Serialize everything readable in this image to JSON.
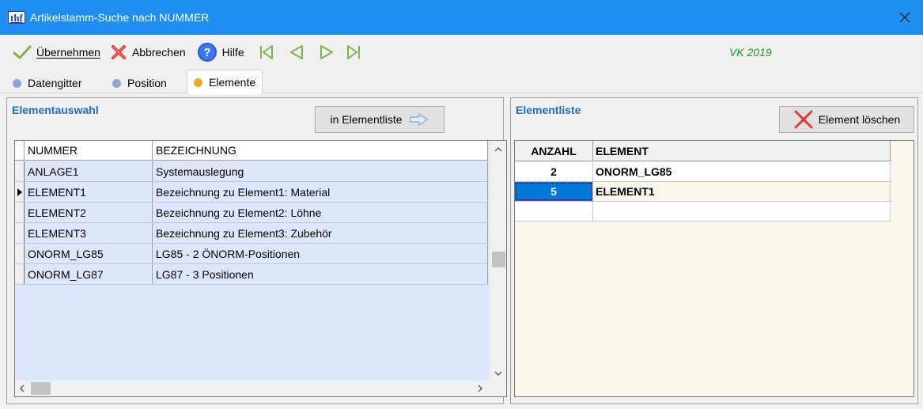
{
  "window": {
    "logo": "thf",
    "title": "Artikelstamm-Suche nach NUMMER",
    "close": "✕"
  },
  "toolbar": {
    "accept_label": "Übernehmen",
    "cancel_label": "Abbrechen",
    "help_label": "Hilfe",
    "vk_label": "VK 2019"
  },
  "tabs": [
    {
      "label": "Datengitter",
      "dot_color": "#8fa3d6"
    },
    {
      "label": "Position",
      "dot_color": "#8fa3d6"
    },
    {
      "label": "Elemente",
      "dot_color": "#f5a623"
    }
  ],
  "left_panel": {
    "title": "Elementauswahl",
    "button_label": "in Elementliste",
    "columns": [
      "NUMMER",
      "BEZEICHNUNG"
    ],
    "rows": [
      {
        "nummer": "ANLAGE1",
        "bezeichnung": "Systemauslegung",
        "current": false
      },
      {
        "nummer": "ELEMENT1",
        "bezeichnung": "Bezeichnung zu Element1: Material",
        "current": true
      },
      {
        "nummer": "ELEMENT2",
        "bezeichnung": "Bezeichnung zu Element2: Löhne",
        "current": false
      },
      {
        "nummer": "ELEMENT3",
        "bezeichnung": "Bezeichnung zu Element3: Zubehör",
        "current": false
      },
      {
        "nummer": "ONORM_LG85",
        "bezeichnung": "LG85 - 2 ÖNORM-Positionen",
        "current": false
      },
      {
        "nummer": "ONORM_LG87",
        "bezeichnung": "LG87 - 3 Positionen",
        "current": false
      }
    ]
  },
  "right_panel": {
    "title": "Elementliste",
    "button_label": "Element löschen",
    "columns": [
      "ANZAHL",
      "ELEMENT"
    ],
    "rows": [
      {
        "anzahl": "2",
        "element": "ONORM_LG85",
        "selected": false
      },
      {
        "anzahl": "5",
        "element": "ELEMENT1",
        "selected": true
      }
    ]
  },
  "colors": {
    "titlebar": "#1e8ff0",
    "panel_title": "#1b6ec2",
    "vk_label": "#1d9a1d",
    "selection": "#0078d7"
  }
}
